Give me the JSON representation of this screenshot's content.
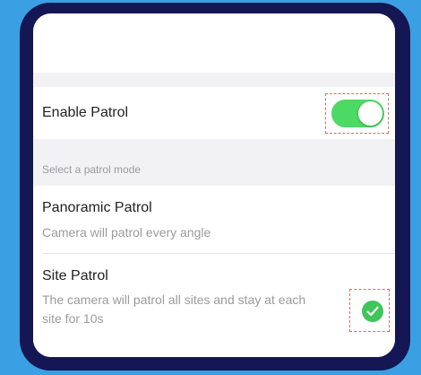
{
  "enable_patrol": {
    "label": "Enable Patrol",
    "enabled": true
  },
  "mode_section": {
    "header": "Select a patrol mode"
  },
  "options": [
    {
      "title": "Panoramic Patrol",
      "description": "Camera will patrol every angle",
      "selected": false
    },
    {
      "title": "Site Patrol",
      "description_line1": "The camera will patrol all sites and stay at each",
      "description_line2": "site for 10s",
      "selected": true
    }
  ],
  "colors": {
    "background": "#3ba0e3",
    "frame": "#141753",
    "toggle_on": "#4cd964",
    "check": "#3fc55a",
    "highlight": "#e2685c"
  },
  "icons": {
    "selected_indicator": "checkmark-circle-icon"
  }
}
